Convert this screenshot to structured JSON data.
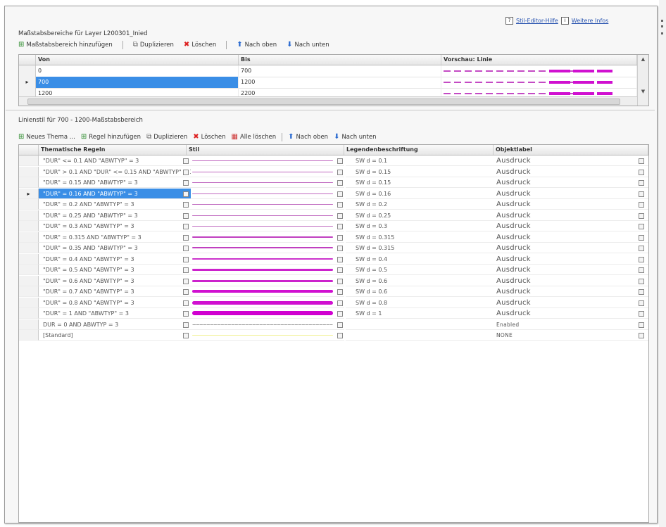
{
  "links": {
    "help": "Stil-Editor-Hilfe",
    "more": "Weitere Infos"
  },
  "scale_section": {
    "title": "Maßstabsbereiche für Layer L200301_Inied",
    "toolbar": {
      "add": "Maßstabsbereich hinzufügen",
      "duplicate": "Duplizieren",
      "delete": "Löschen",
      "up": "Nach oben",
      "down": "Nach unten"
    },
    "columns": [
      "Von",
      "Bis",
      "Vorschau: Linie"
    ],
    "rows": [
      {
        "from": "0",
        "to": "700"
      },
      {
        "from": "700",
        "to": "1200"
      },
      {
        "from": "1200",
        "to": "2200"
      }
    ]
  },
  "theme_section": {
    "title": "Linienstil für 700 - 1200-Maßstabsbereich",
    "toolbar": {
      "new_theme": "Neues Thema ...",
      "add_rule": "Regel hinzufügen",
      "duplicate": "Duplizieren",
      "delete": "Löschen",
      "delete_all": "Alle löschen",
      "up": "Nach oben",
      "down": "Nach unten"
    },
    "columns": [
      "Thematische Regeln",
      "Stil",
      "Legendenbeschriftung",
      "Objektlabel"
    ],
    "rows": [
      {
        "rule": "\"DUR\" <= 0.1 AND \"ABWTYP\" = 3",
        "legend": "SW d = 0.1",
        "label": "Ausdruck",
        "line_color": "#c06ac0",
        "line_width": 1,
        "dashed": false
      },
      {
        "rule": "\"DUR\" > 0.1 AND \"DUR\" <= 0.15 AND \"ABWTYP\" = 3",
        "legend": "SW d = 0.15",
        "label": "Ausdruck",
        "line_color": "#c06ac0",
        "line_width": 1,
        "dashed": false
      },
      {
        "rule": "\"DUR\" = 0.15 AND \"ABWTYP\" = 3",
        "legend": "SW d = 0.15",
        "label": "Ausdruck",
        "line_color": "#c06ac0",
        "line_width": 1,
        "dashed": false
      },
      {
        "rule": "\"DUR\" = 0.16 AND \"ABWTYP\" = 3",
        "legend": "SW d = 0.16",
        "label": "Ausdruck",
        "line_color": "#c06ac0",
        "line_width": 1,
        "dashed": false
      },
      {
        "rule": "\"DUR\" = 0.2 AND \"ABWTYP\" = 3",
        "legend": "SW d = 0.2",
        "label": "Ausdruck",
        "line_color": "#c06ac0",
        "line_width": 1,
        "dashed": false
      },
      {
        "rule": "\"DUR\" = 0.25 AND \"ABWTYP\" = 3",
        "legend": "SW d = 0.25",
        "label": "Ausdruck",
        "line_color": "#c06ac0",
        "line_width": 1,
        "dashed": false
      },
      {
        "rule": "\"DUR\" = 0.3 AND \"ABWTYP\" = 3",
        "legend": "SW d = 0.3",
        "label": "Ausdruck",
        "line_color": "#c06ac0",
        "line_width": 1,
        "dashed": false
      },
      {
        "rule": "\"DUR\" = 0.315 AND \"ABWTYP\" = 3",
        "legend": "SW d = 0.315",
        "label": "Ausdruck",
        "line_color": "#c040c0",
        "line_width": 2,
        "dashed": false
      },
      {
        "rule": "\"DUR\" = 0.35 AND \"ABWTYP\" = 3",
        "legend": "SW d = 0.315",
        "label": "Ausdruck",
        "line_color": "#c040c0",
        "line_width": 2,
        "dashed": false
      },
      {
        "rule": "\"DUR\" = 0.4 AND \"ABWTYP\" = 3",
        "legend": "SW d = 0.4",
        "label": "Ausdruck",
        "line_color": "#cc33cc",
        "line_width": 2,
        "dashed": false
      },
      {
        "rule": "\"DUR\" = 0.5 AND \"ABWTYP\" = 3",
        "legend": "SW d = 0.5",
        "label": "Ausdruck",
        "line_color": "#cc22cc",
        "line_width": 3,
        "dashed": false
      },
      {
        "rule": "\"DUR\" = 0.6 AND \"ABWTYP\" = 3",
        "legend": "SW d = 0.6",
        "label": "Ausdruck",
        "line_color": "#cc22cc",
        "line_width": 3,
        "dashed": false
      },
      {
        "rule": "\"DUR\" = 0.7 AND \"ABWTYP\" = 3",
        "legend": "SW d = 0.6",
        "label": "Ausdruck",
        "line_color": "#d010d0",
        "line_width": 4,
        "dashed": false
      },
      {
        "rule": "\"DUR\" = 0.8 AND \"ABWTYP\" = 3",
        "legend": "SW d = 0.8",
        "label": "Ausdruck",
        "line_color": "#d010d0",
        "line_width": 5,
        "dashed": false
      },
      {
        "rule": "\"DUR\" = 1 AND \"ABWTYP\" = 3",
        "legend": "SW d = 1",
        "label": "Ausdruck",
        "line_color": "#d000d0",
        "line_width": 6,
        "dashed": false
      },
      {
        "rule": "DUR = 0 AND ABWTYP = 3",
        "legend": "",
        "label": "Enabled",
        "line_color": "#999999",
        "line_width": 1,
        "dashed": true
      },
      {
        "rule": "[Standard]",
        "legend": "",
        "label": "NONE",
        "line_color": "#f2f29a",
        "line_width": 1,
        "dashed": false
      }
    ]
  }
}
